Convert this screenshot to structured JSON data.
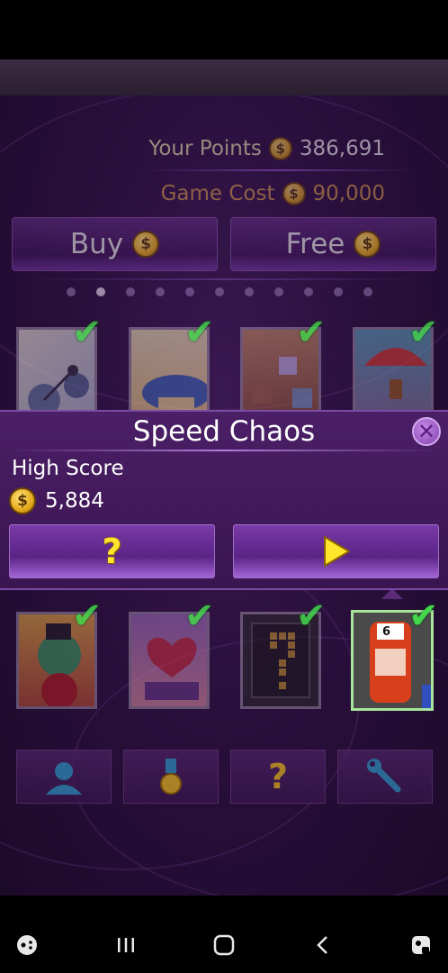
{
  "header": {
    "points_label": "Your Points",
    "points_value": "386,691",
    "cost_label": "Game Cost",
    "cost_value": "90,000"
  },
  "buttons": {
    "buy_label": "Buy",
    "free_label": "Free"
  },
  "pager": {
    "total": 11,
    "active_index": 1
  },
  "game_tiles_top": [
    {
      "name": "yarn-game",
      "checked": true
    },
    {
      "name": "mushroom-game",
      "checked": true
    },
    {
      "name": "blocks-game",
      "checked": true
    },
    {
      "name": "parachute-game",
      "checked": true
    }
  ],
  "popup": {
    "title": "Speed Chaos",
    "high_score_label": "High Score",
    "high_score_value": "5,884",
    "help_glyph": "?"
  },
  "game_tiles_bottom": [
    {
      "name": "clown-game",
      "checked": true
    },
    {
      "name": "love-game",
      "checked": true
    },
    {
      "name": "mystery-game",
      "checked": true
    },
    {
      "name": "speed-chaos-game",
      "checked": true,
      "selected": true,
      "car_number": "6"
    }
  ],
  "bottom_menu": [
    {
      "name": "profile-icon"
    },
    {
      "name": "medal-icon"
    },
    {
      "name": "help-icon",
      "glyph": "?"
    },
    {
      "name": "settings-wrench-icon"
    }
  ],
  "colors": {
    "accent_purple": "#4b1f67",
    "check_green": "#42d64a",
    "coin_gold": "#e4a91c"
  }
}
